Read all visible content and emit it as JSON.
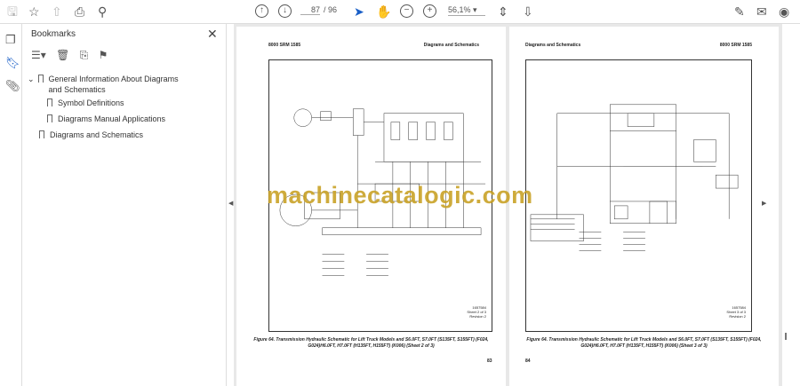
{
  "toolbar": {
    "page_current": "87",
    "page_total": "/ 96",
    "zoom": "56,1%"
  },
  "bookmarks": {
    "title": "Bookmarks",
    "items": [
      {
        "label": "General Information About Diagrams and Schematics"
      },
      {
        "label": "Symbol Definitions"
      },
      {
        "label": "Diagrams Manual Applications"
      },
      {
        "label": "Diagrams and Schematics"
      }
    ]
  },
  "pages": [
    {
      "header_left": "8000 SRM 1585",
      "header_right": "Diagrams and Schematics",
      "sheet": "1657584\nSheet 2 of 3\nRevision 2",
      "caption": "Figure 64. Transmission Hydraulic Schematic for Lift Truck Models and S6.0FT, S7.0FT (S135FT, S155FT) (F024, G024)H6.0FT, H7.0FT (H135FT, H155FT) (K006) (Sheet 2 of 3)",
      "page_number": "83"
    },
    {
      "header_left": "Diagrams and Schematics",
      "header_right": "8000 SRM 1585",
      "sheet": "1657584\nSheet 3 of 3\nRevision 2",
      "caption": "Figure 64. Transmission Hydraulic Schematic for Lift Truck Models and S6.0FT, S7.0FT (S135FT, S155FT) (F024, G024)H6.0FT, H7.0FT (H135FT, H155FT) (K006) (Sheet 3 of 3)",
      "page_number": "84"
    }
  ],
  "watermark": "machinecatalogic.com"
}
